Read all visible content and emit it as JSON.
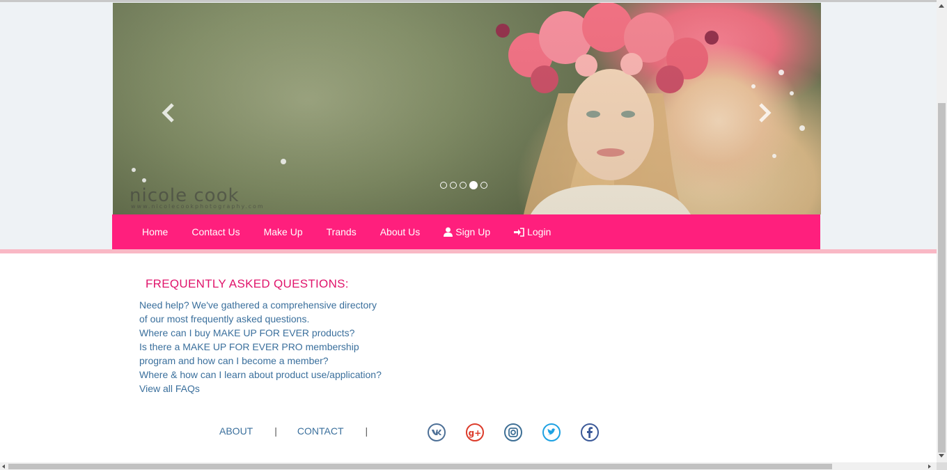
{
  "carousel": {
    "watermark": "nicole cook",
    "watermark_sub": "www.nicolecookphotography.com",
    "slide_count": 5,
    "active_slide": 4
  },
  "nav": {
    "items": [
      {
        "label": "Home"
      },
      {
        "label": "Contact Us"
      },
      {
        "label": "Make Up"
      },
      {
        "label": "Trands"
      },
      {
        "label": "About Us"
      },
      {
        "label": "Sign Up",
        "icon": "user-icon"
      },
      {
        "label": "Login",
        "icon": "login-icon"
      }
    ]
  },
  "faq": {
    "title": "FREQUENTLY ASKED QUESTIONS:",
    "lines": [
      "Need help? We've gathered a comprehensive directory",
      "of our most frequently asked questions.",
      "Where can I buy MAKE UP FOR EVER products?",
      "Is there a MAKE UP FOR EVER PRO membership",
      "program and how can I become a member?",
      "Where & how can I learn about product use/application?",
      "View all FAQs"
    ]
  },
  "footer": {
    "about": "ABOUT",
    "separator": "|",
    "contact": "CONTACT",
    "social": [
      "vk-icon",
      "google-plus-icon",
      "instagram-icon",
      "twitter-icon",
      "facebook-icon"
    ]
  },
  "colors": {
    "nav_bg": "#ff1f7d",
    "faq_title": "#e0146b",
    "link": "#3a6f9c",
    "vk": "#4c6f96",
    "google_plus": "#dc3b2a",
    "instagram": "#3e6f95",
    "twitter": "#1da1e2",
    "facebook": "#3b5998"
  }
}
